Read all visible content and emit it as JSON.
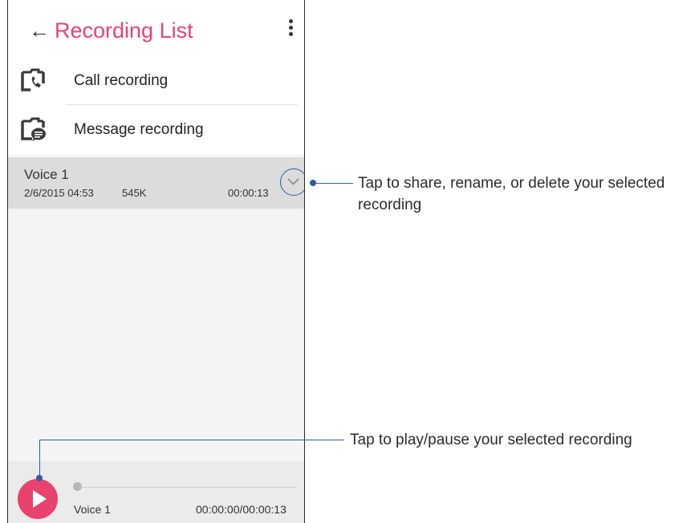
{
  "header": {
    "back_icon": "arrow-left-icon",
    "title": "Recording List",
    "menu_icon": "more-vertical-icon",
    "accent_color": "#e8426e"
  },
  "folders": [
    {
      "label": "Call recording",
      "icon": "call-folder-icon"
    },
    {
      "label": "Message recording",
      "icon": "message-folder-icon"
    }
  ],
  "selected_recording": {
    "name": "Voice 1",
    "date": "2/6/2015 04:53",
    "size": "545K",
    "duration": "00:00:13",
    "expand_icon": "chevron-down-icon"
  },
  "player": {
    "play_icon": "play-icon",
    "track_name": "Voice 1",
    "time": "00:00:00/00:00:13",
    "progress": 0
  },
  "callouts": {
    "expand_text": "Tap to share, rename, or delete your selected recording",
    "play_text": "Tap to play/pause your selected recording",
    "line_color": "#2a5ea8"
  }
}
